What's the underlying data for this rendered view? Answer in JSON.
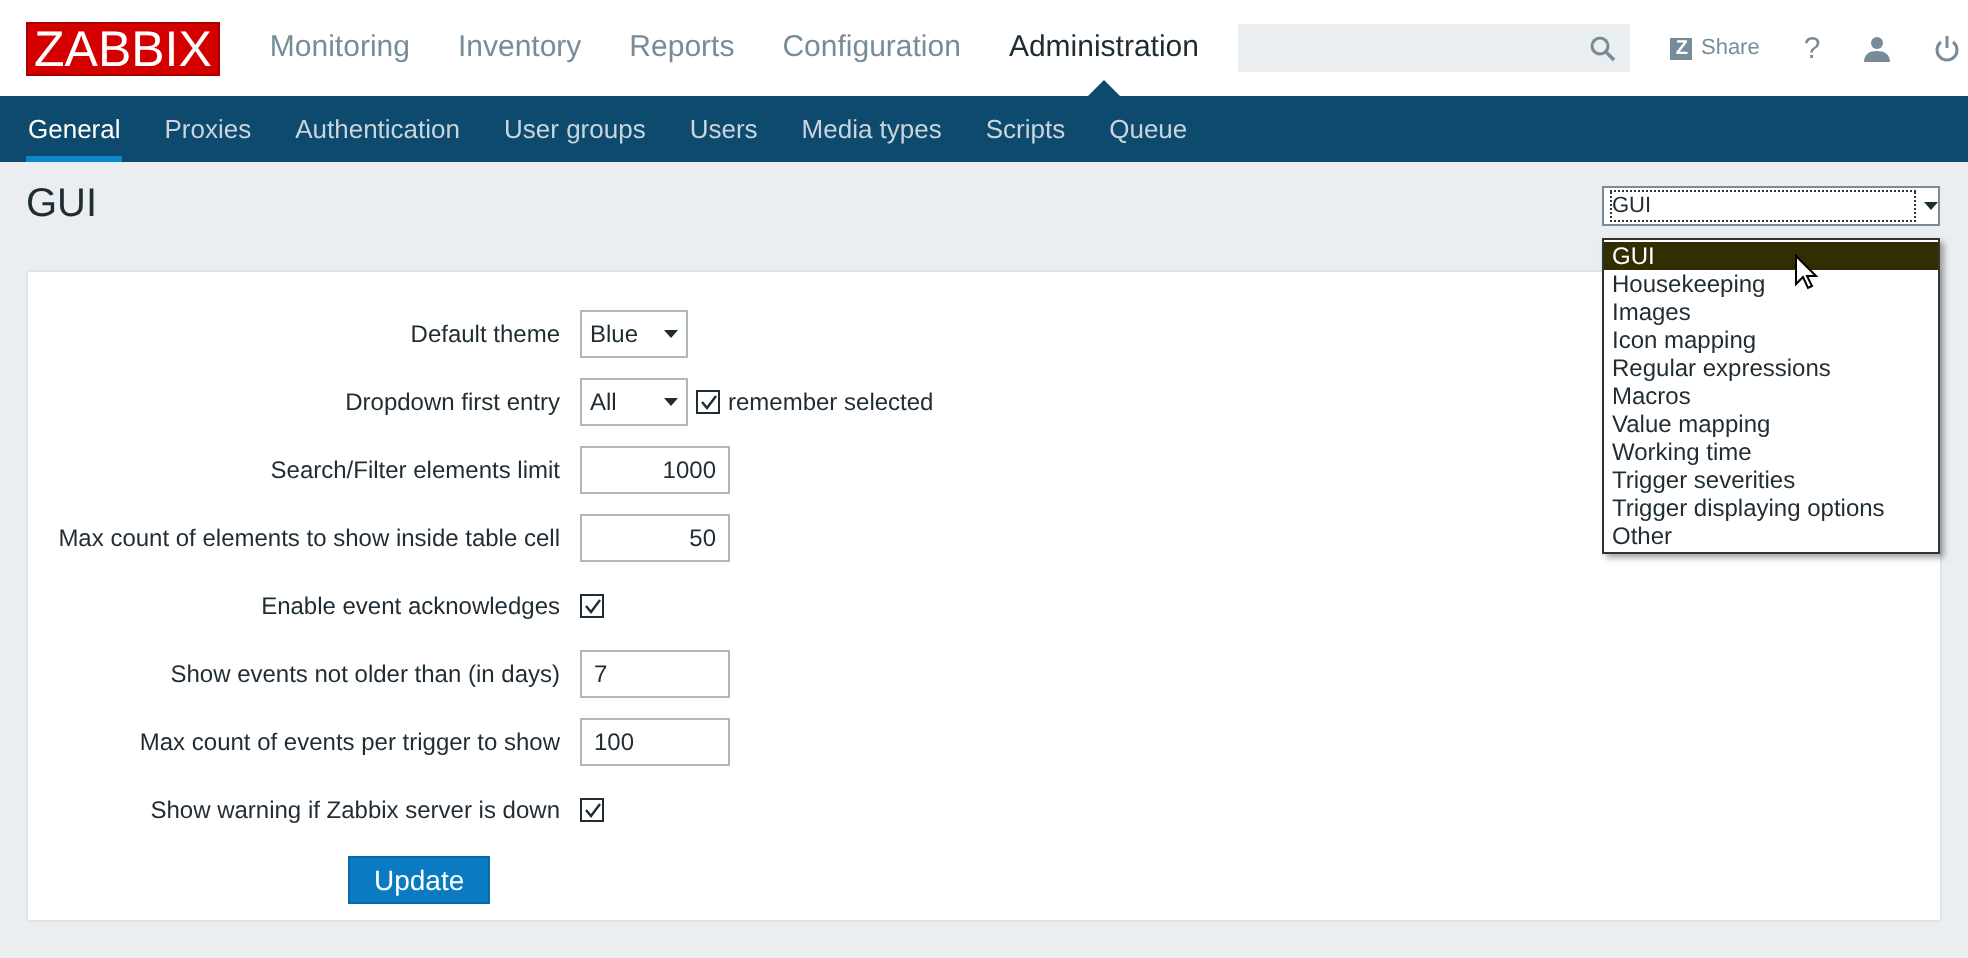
{
  "header": {
    "logo": "ZABBIX",
    "menu": [
      {
        "label": "Monitoring",
        "selected": false
      },
      {
        "label": "Inventory",
        "selected": false
      },
      {
        "label": "Reports",
        "selected": false
      },
      {
        "label": "Configuration",
        "selected": false
      },
      {
        "label": "Administration",
        "selected": true
      }
    ],
    "share": {
      "badge": "Z",
      "label": "Share"
    },
    "help": "?"
  },
  "subnav": [
    {
      "label": "General",
      "selected": true
    },
    {
      "label": "Proxies",
      "selected": false
    },
    {
      "label": "Authentication",
      "selected": false
    },
    {
      "label": "User groups",
      "selected": false
    },
    {
      "label": "Users",
      "selected": false
    },
    {
      "label": "Media types",
      "selected": false
    },
    {
      "label": "Scripts",
      "selected": false
    },
    {
      "label": "Queue",
      "selected": false
    }
  ],
  "title": "GUI",
  "page_select": {
    "value": "GUI",
    "options": [
      {
        "label": "GUI",
        "selected": true
      },
      {
        "label": "Housekeeping",
        "selected": false
      },
      {
        "label": "Images",
        "selected": false
      },
      {
        "label": "Icon mapping",
        "selected": false
      },
      {
        "label": "Regular expressions",
        "selected": false
      },
      {
        "label": "Macros",
        "selected": false
      },
      {
        "label": "Value mapping",
        "selected": false
      },
      {
        "label": "Working time",
        "selected": false
      },
      {
        "label": "Trigger severities",
        "selected": false
      },
      {
        "label": "Trigger displaying options",
        "selected": false
      },
      {
        "label": "Other",
        "selected": false
      }
    ]
  },
  "form": [
    {
      "kind": "select",
      "label": "Default theme",
      "value": "Blue"
    },
    {
      "kind": "select",
      "label": "Dropdown first entry",
      "value": "All",
      "checked": true,
      "checkbox_label": "remember selected"
    },
    {
      "kind": "number",
      "label": "Search/Filter elements limit",
      "value": "1000"
    },
    {
      "kind": "number",
      "label": "Max count of elements to show inside table cell",
      "value": "50"
    },
    {
      "kind": "checkbox",
      "label": "Enable event acknowledges",
      "checked": true
    },
    {
      "kind": "text",
      "label": "Show events not older than (in days)",
      "value": "7"
    },
    {
      "kind": "text",
      "label": "Max count of events per trigger to show",
      "value": "100"
    },
    {
      "kind": "checkbox",
      "label": "Show warning if Zabbix server is down",
      "checked": true
    }
  ],
  "button": "Update"
}
